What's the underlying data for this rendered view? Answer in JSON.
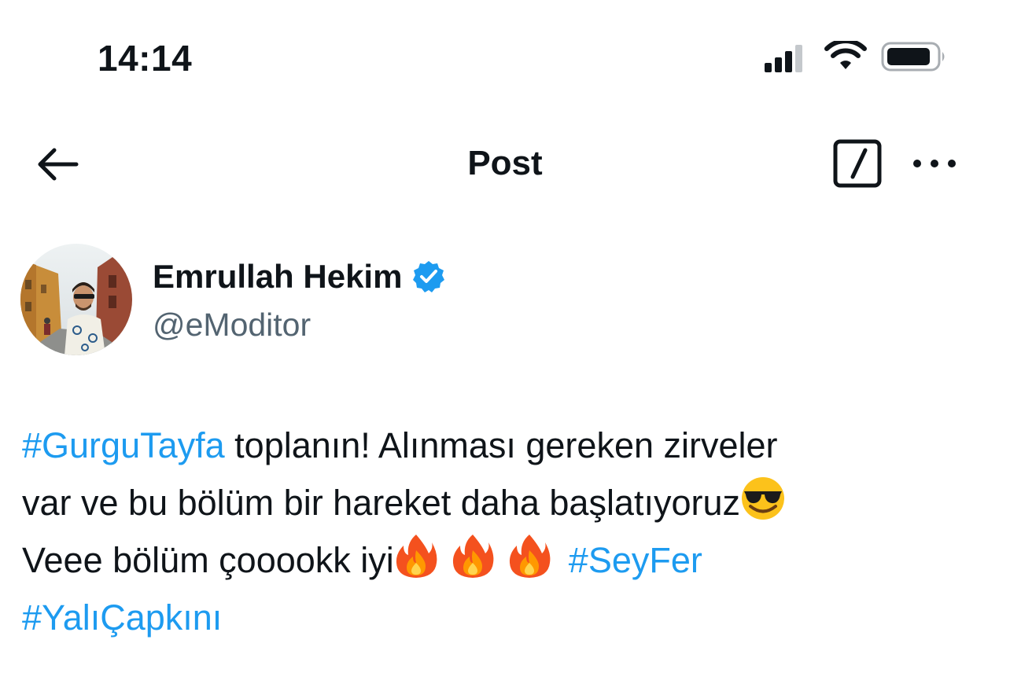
{
  "status_bar": {
    "time": "14:14",
    "icons": [
      "cellular-signal-icon",
      "wifi-icon",
      "battery-icon"
    ]
  },
  "nav": {
    "back_icon": "arrow-left-icon",
    "title": "Post",
    "edit_icon": "edit-square-icon",
    "more_icon": "more-horizontal-icon"
  },
  "author": {
    "name": "Emrullah Hekim",
    "handle": "@eModitor",
    "verified": true,
    "verified_color": "#1d9bf0"
  },
  "post": {
    "hashtag_1": "#GurguTayfa",
    "text_1": " toplanın! Alınması gereken zirveler",
    "text_2": "var ve bu bölüm bir hareket daha başlatıyoruz",
    "emoji_1": "smiling-face-with-sunglasses",
    "text_3": "Veee bölüm çooookk iyi",
    "emoji_fire": "fire",
    "hashtag_2": "#SeyFer",
    "hashtag_3": "#YalıÇapkını"
  },
  "colors": {
    "text": "#0f1419",
    "secondary_text": "#536471",
    "link": "#1d9bf0",
    "background": "#ffffff"
  }
}
